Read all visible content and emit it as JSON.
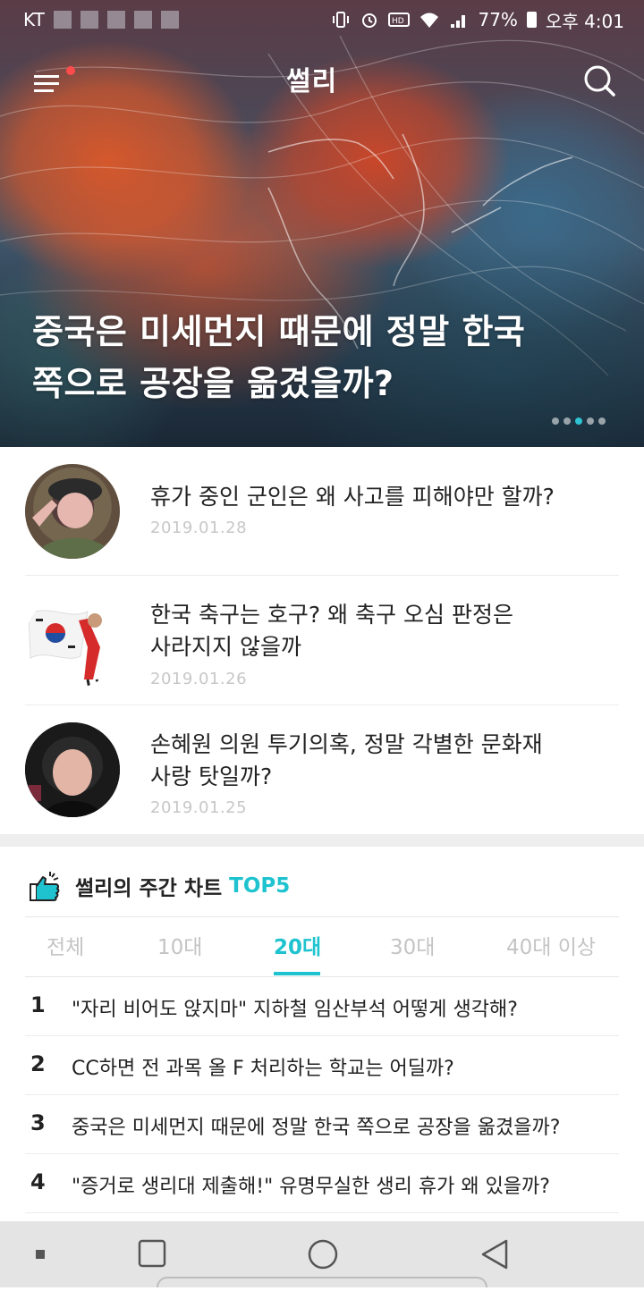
{
  "status_bar": {
    "carrier": "KT",
    "battery": "77%",
    "time": "오후 4:01"
  },
  "app": {
    "logo": "썰리",
    "accent_color": "#1ec3cf",
    "menu_badge_color": "#ff4b4b"
  },
  "hero": {
    "title_line1": "중국은 미세먼지 때문에 정말 한국",
    "title_line2": "쪽으로 공장을 옮겼을까?",
    "pager_count": 5,
    "pager_active_index": 2
  },
  "articles": [
    {
      "title_line1": "휴가 중인 군인은 왜 사고를 피해야만 할까?",
      "title_line2": "",
      "date": "2019.01.28"
    },
    {
      "title_line1": "한국 축구는 호구? 왜 축구 오심 판정은",
      "title_line2": "사라지지 않을까",
      "date": "2019.01.26"
    },
    {
      "title_line1": "손혜원 의원 투기의혹, 정말 각별한 문화재",
      "title_line2": "사랑 탓일까?",
      "date": "2019.01.25"
    }
  ],
  "weekly_chart": {
    "heading": "썰리의 주간 차트",
    "heading_accent": "TOP5",
    "tabs": [
      "전체",
      "10대",
      "20대",
      "30대",
      "40대 이상"
    ],
    "active_tab": "20대",
    "rankings": [
      {
        "rank": "1",
        "title": "\"자리 비어도 앉지마\" 지하철 임산부석 어떻게 생각해?"
      },
      {
        "rank": "2",
        "title": "CC하면 전 과목 올 F 처리하는 학교는 어딜까?"
      },
      {
        "rank": "3",
        "title": "중국은 미세먼지 때문에 정말 한국 쪽으로 공장을 옮겼을까?"
      },
      {
        "rank": "4",
        "title": "\"증거로 생리대 제출해!\" 유명무실한 생리 휴가 왜 있을까?"
      }
    ]
  },
  "icons": {
    "menu": "hamburger-menu-icon",
    "search": "search-icon",
    "thumbs_up": "thumbs-up-icon",
    "nav_recent": "recents-square-icon",
    "nav_home": "home-circle-icon",
    "nav_back": "back-triangle-icon"
  }
}
